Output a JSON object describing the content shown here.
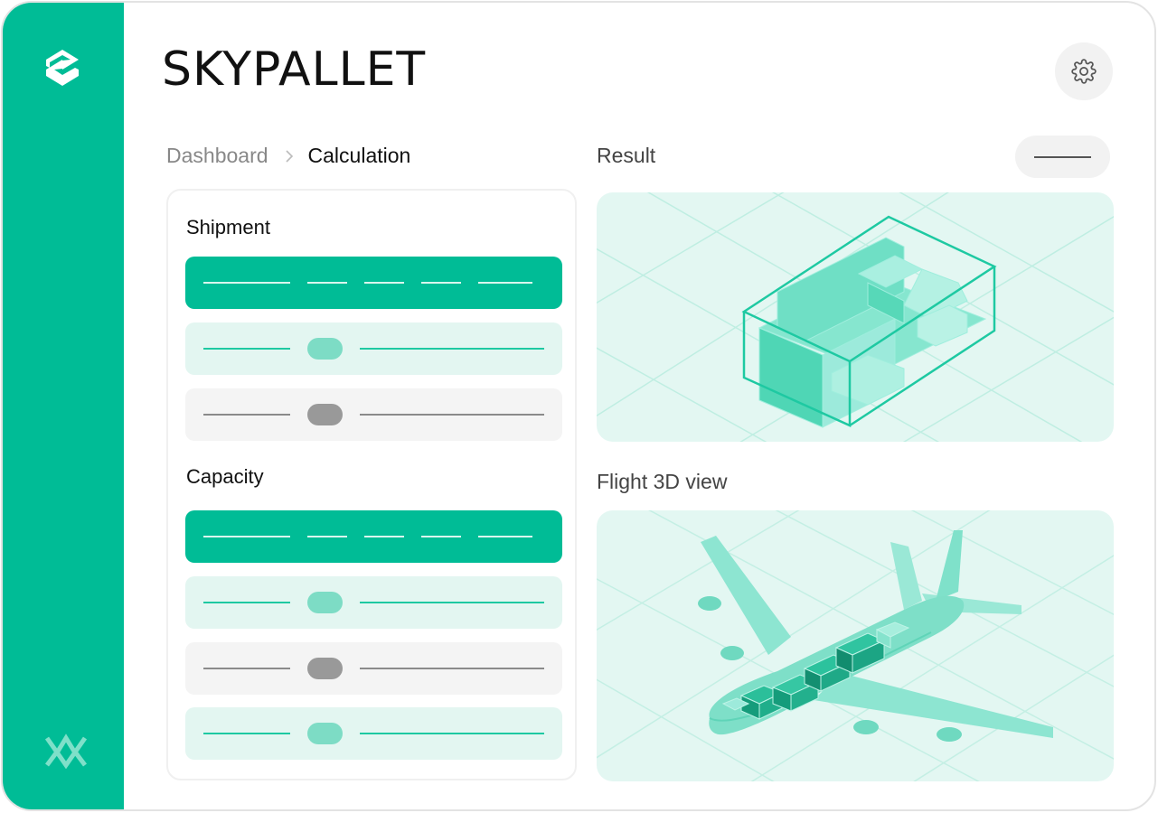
{
  "app": {
    "title": "SKYPALLET"
  },
  "breadcrumb": {
    "items": [
      "Dashboard",
      "Calculation"
    ]
  },
  "left_panel": {
    "sections": [
      {
        "title": "Shipment"
      },
      {
        "title": "Capacity"
      }
    ]
  },
  "result": {
    "label": "Result"
  },
  "flight_view": {
    "label": "Flight 3D view"
  },
  "colors": {
    "accent": "#00bc96",
    "soft_accent": "#e3f6f1",
    "neutral": "#f4f4f4"
  },
  "icons": {
    "sidebar_top": "skypallet-logo-icon",
    "sidebar_bottom": "brand-mark-icon",
    "settings": "gear-icon",
    "breadcrumb_separator": "chevron-right-icon"
  }
}
